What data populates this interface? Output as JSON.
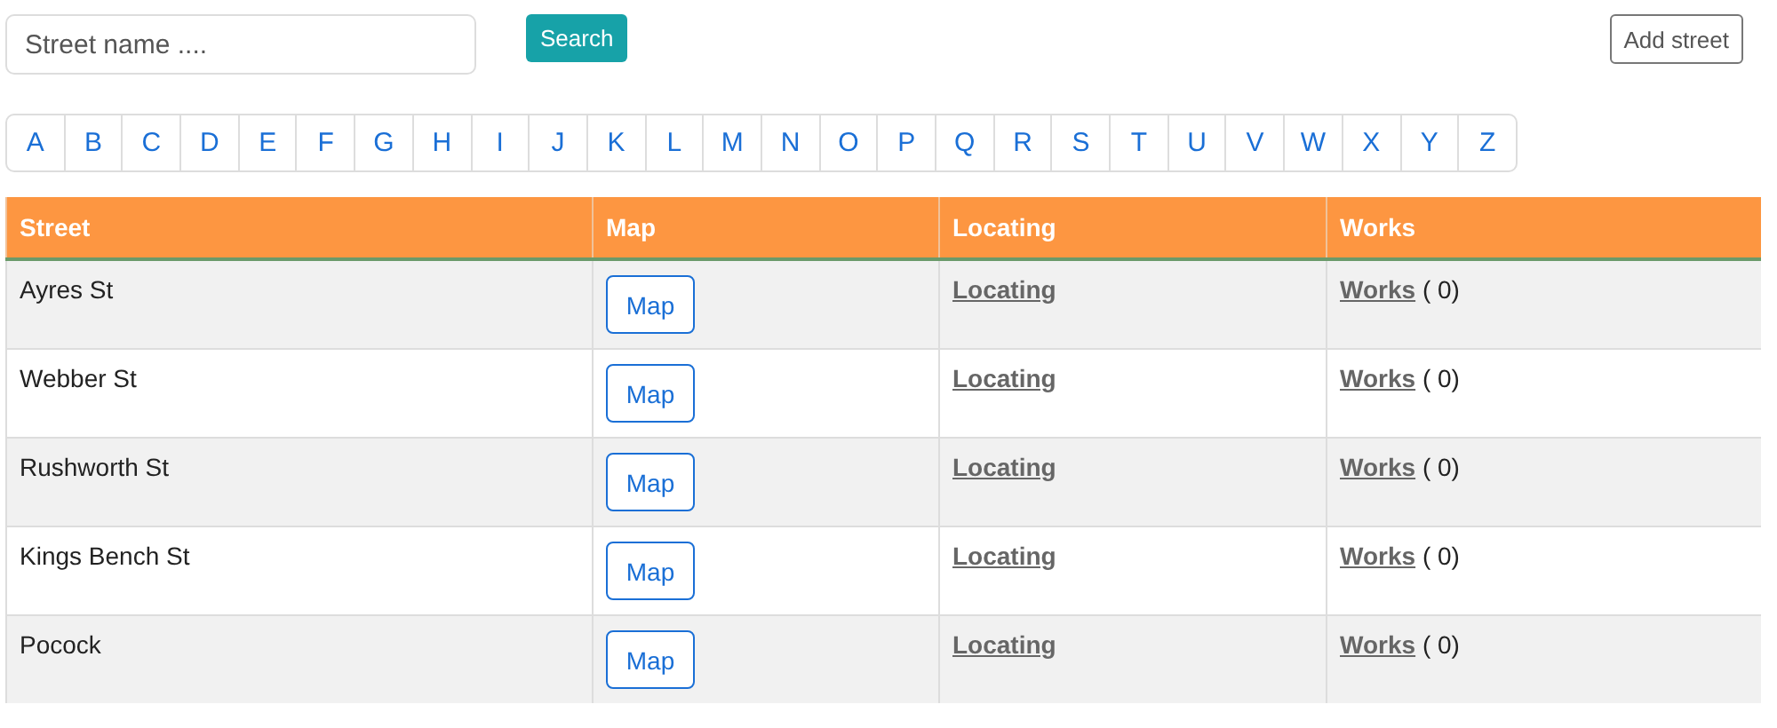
{
  "search": {
    "placeholder": "Street name ....",
    "button": "Search"
  },
  "add_button": "Add street",
  "letters": [
    "A",
    "B",
    "C",
    "D",
    "E",
    "F",
    "G",
    "H",
    "I",
    "J",
    "K",
    "L",
    "M",
    "N",
    "O",
    "P",
    "Q",
    "R",
    "S",
    "T",
    "U",
    "V",
    "W",
    "X",
    "Y",
    "Z"
  ],
  "table": {
    "columns": [
      "Street",
      "Map",
      "Locating",
      "Works"
    ],
    "rows": [
      {
        "street": "Ayres St",
        "map": "Map",
        "locating": "Locating",
        "works": "Works",
        "count": "( 0)"
      },
      {
        "street": "Webber St",
        "map": "Map",
        "locating": "Locating",
        "works": "Works",
        "count": "( 0)"
      },
      {
        "street": "Rushworth St",
        "map": "Map",
        "locating": "Locating",
        "works": "Works",
        "count": "( 0)"
      },
      {
        "street": "Kings Bench St",
        "map": "Map",
        "locating": "Locating",
        "works": "Works",
        "count": "( 0)"
      },
      {
        "street": "Pocock",
        "map": "Map",
        "locating": "Locating",
        "works": "Works",
        "count": "( 0)"
      }
    ]
  }
}
